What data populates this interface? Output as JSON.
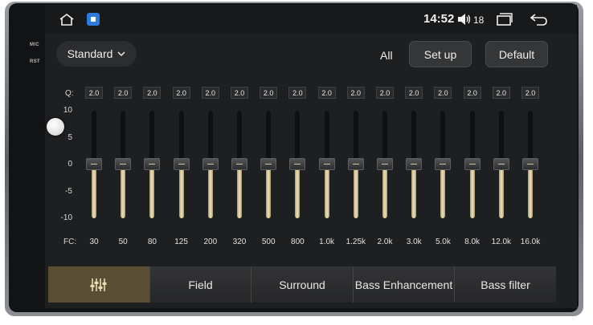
{
  "hardware": {
    "mic_label": "MIC",
    "rst_label": "RST"
  },
  "status_bar": {
    "icons": [
      "home-icon",
      "app-icon",
      "volume-icon",
      "recent-apps-icon",
      "back-icon"
    ],
    "time": "14:52",
    "volume_level": "18"
  },
  "header": {
    "preset": "Standard",
    "all_label": "All",
    "setup_label": "Set up",
    "default_label": "Default"
  },
  "equalizer": {
    "q_label": "Q:",
    "fc_label": "FC:",
    "gain_ticks": [
      "10",
      "5",
      "0",
      "-5",
      "-10"
    ],
    "gain_range": [
      -10,
      10
    ],
    "bands": [
      {
        "fc": "30",
        "q": "2.0",
        "gain": 0
      },
      {
        "fc": "50",
        "q": "2.0",
        "gain": 0
      },
      {
        "fc": "80",
        "q": "2.0",
        "gain": 0
      },
      {
        "fc": "125",
        "q": "2.0",
        "gain": 0
      },
      {
        "fc": "200",
        "q": "2.0",
        "gain": 0
      },
      {
        "fc": "320",
        "q": "2.0",
        "gain": 0
      },
      {
        "fc": "500",
        "q": "2.0",
        "gain": 0
      },
      {
        "fc": "800",
        "q": "2.0",
        "gain": 0
      },
      {
        "fc": "1.0k",
        "q": "2.0",
        "gain": 0
      },
      {
        "fc": "1.25k",
        "q": "2.0",
        "gain": 0
      },
      {
        "fc": "2.0k",
        "q": "2.0",
        "gain": 0
      },
      {
        "fc": "3.0k",
        "q": "2.0",
        "gain": 0
      },
      {
        "fc": "5.0k",
        "q": "2.0",
        "gain": 0
      },
      {
        "fc": "8.0k",
        "q": "2.0",
        "gain": 0
      },
      {
        "fc": "12.0k",
        "q": "2.0",
        "gain": 0
      },
      {
        "fc": "16.0k",
        "q": "2.0",
        "gain": 0
      }
    ]
  },
  "tabs": [
    {
      "label": "",
      "icon": "equalizer-icon",
      "active": true
    },
    {
      "label": "Field",
      "active": false
    },
    {
      "label": "Surround",
      "active": false
    },
    {
      "label": "Bass Enhancement",
      "active": false
    },
    {
      "label": "Bass filter",
      "active": false
    }
  ],
  "colors": {
    "accent": "#5a4f34",
    "slider_fill": "#efe3b8",
    "background": "#1e1f21"
  }
}
